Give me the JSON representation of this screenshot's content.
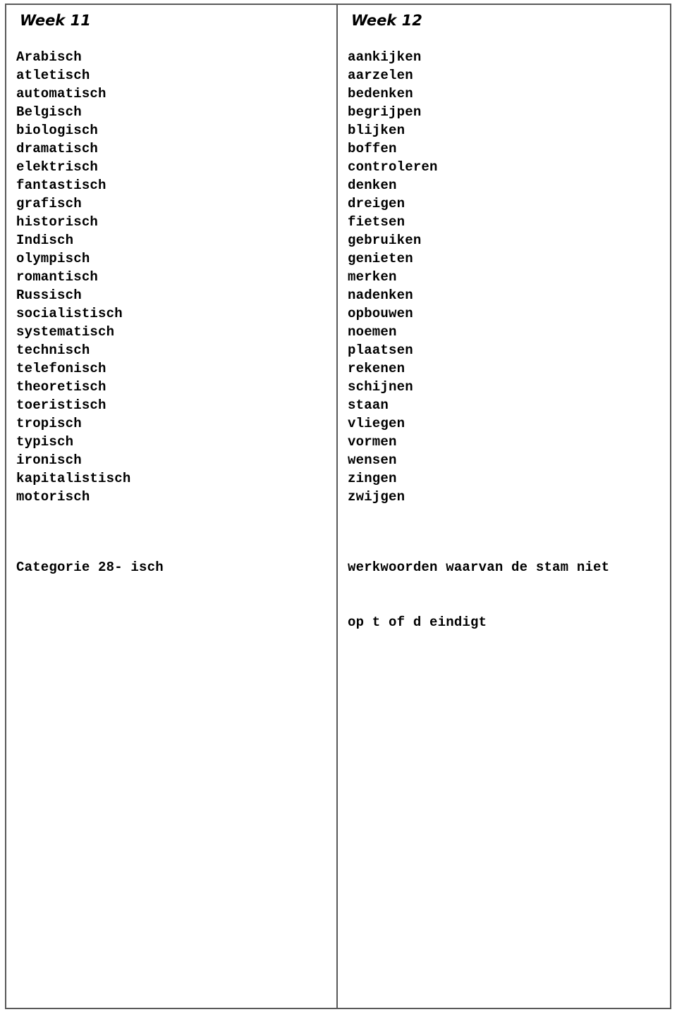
{
  "page": {
    "background_color": "#ffffff",
    "text_color": "#000000",
    "border_color": "#595959"
  },
  "table": {
    "columns": [
      {
        "heading": "Week 11",
        "words": [
          "Arabisch",
          "atletisch",
          "automatisch",
          "Belgisch",
          "biologisch",
          "dramatisch",
          "elektrisch",
          "fantastisch",
          "grafisch",
          "historisch",
          "Indisch",
          "olympisch",
          "romantisch",
          "Russisch",
          "socialistisch",
          "systematisch",
          "technisch",
          "telefonisch",
          "theoretisch",
          "toeristisch",
          "tropisch",
          "typisch",
          "ironisch",
          "kapitalistisch",
          "motorisch"
        ],
        "note_lines": [
          "Categorie 28- isch"
        ]
      },
      {
        "heading": "Week 12",
        "words": [
          "aankijken",
          "aarzelen",
          "bedenken",
          "begrijpen",
          "blijken",
          "boffen",
          "controleren",
          "denken",
          "dreigen",
          "fietsen",
          "gebruiken",
          "genieten",
          "merken",
          "nadenken",
          "opbouwen",
          "noemen",
          "plaatsen",
          "rekenen",
          "schijnen",
          "staan",
          "vliegen",
          "vormen",
          "wensen",
          "zingen",
          "zwijgen"
        ],
        "note_lines": [
          "werkwoorden waarvan de stam niet",
          "op t of d eindigt"
        ]
      }
    ]
  }
}
